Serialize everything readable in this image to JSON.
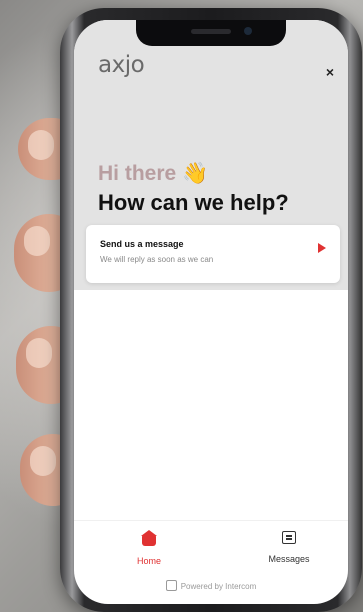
{
  "app": {
    "logo": "axjo",
    "close_glyph": "×"
  },
  "home": {
    "greeting": "Hi there",
    "greeting_emoji": "👋",
    "headline": "How can we help?"
  },
  "message_card": {
    "title": "Send us a message",
    "subtitle": "We will reply as soon as we can",
    "icon": "send-arrow-icon"
  },
  "bottom_nav": {
    "items": [
      {
        "label": "Home",
        "icon": "home-icon",
        "active": true
      },
      {
        "label": "Messages",
        "icon": "messages-icon",
        "active": false
      }
    ]
  },
  "footer": {
    "powered_by": "Powered by Intercom"
  },
  "colors": {
    "accent": "#e03232",
    "greeting": "#b89ea0",
    "header_bg": "#e3e3e3"
  }
}
